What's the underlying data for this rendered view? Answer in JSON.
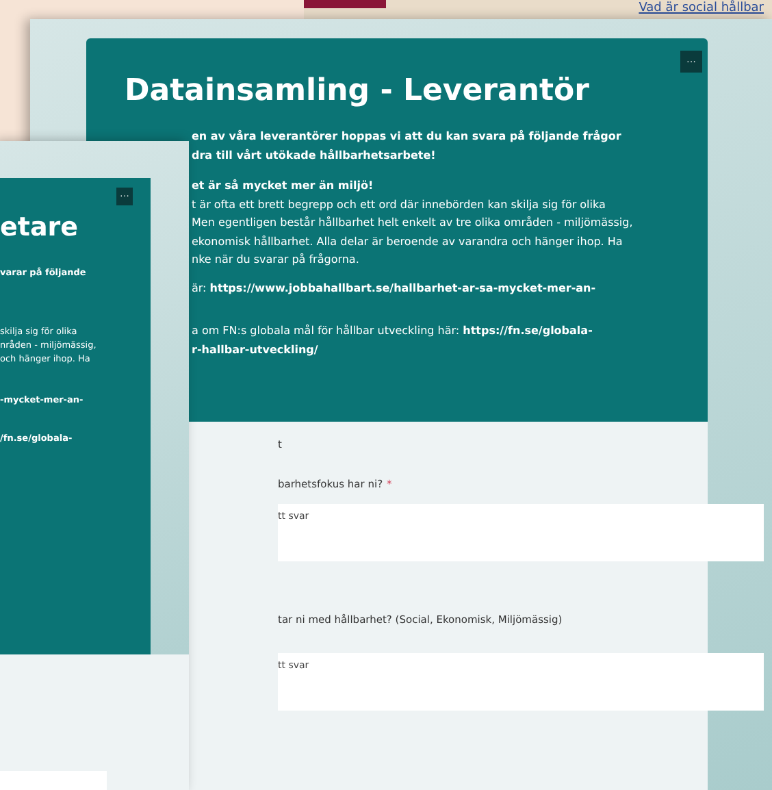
{
  "background_page": {
    "link": "Vad är social hållbar"
  },
  "front_form": {
    "title": "Datainsamling - Leverantör",
    "menu_button": "···",
    "intro": [
      "en av våra leverantörer hoppas vi att du kan svara på följande frågor",
      "dra till vårt utökade hållbarhetsarbete!"
    ],
    "subheading": "et är så mycket mer än miljö!",
    "paragraph": [
      "t är ofta ett brett begrepp och ett ord där innebörden kan skilja sig för olika",
      "Men egentligen består hållbarhet helt enkelt av tre olika områden - miljömässig,",
      "ekonomisk hållbarhet. Alla delar är beroende av varandra och hänger ihop. Ha",
      "nke när du svarar på frågorna."
    ],
    "links": [
      {
        "lines": [
          "är: **https://www.jobbahallbart.se/hallbarhet-ar-sa-mycket-mer-an-**"
        ]
      },
      {
        "lines": [
          "a om FN:s globala mål för hållbar utveckling här: **https://fn.se/globala-**",
          "**r-hallbar-utveckling/**"
        ]
      }
    ],
    "section_label": "t",
    "questions": [
      {
        "label": "barhetsfokus har ni?",
        "required_mark": "*",
        "placeholder": "tt svar"
      },
      {
        "label": "tar ni med hållbarhet? (Social, Ekonomisk, Miljömässig)",
        "placeholder": "tt svar"
      }
    ]
  },
  "side_form": {
    "title": "etare",
    "menu_button": "···",
    "lines": [
      {
        "text": "varar på följande",
        "bold": true
      },
      {
        "text": "skilja sig för olika",
        "bold": false
      },
      {
        "text": "nråden - miljömässig,",
        "bold": false
      },
      {
        "text": "och hänger ihop. Ha",
        "bold": false
      },
      {
        "text": "-mycket-mer-an-",
        "bold": true
      },
      {
        "text": "/fn.se/globala-",
        "bold": true
      }
    ]
  }
}
